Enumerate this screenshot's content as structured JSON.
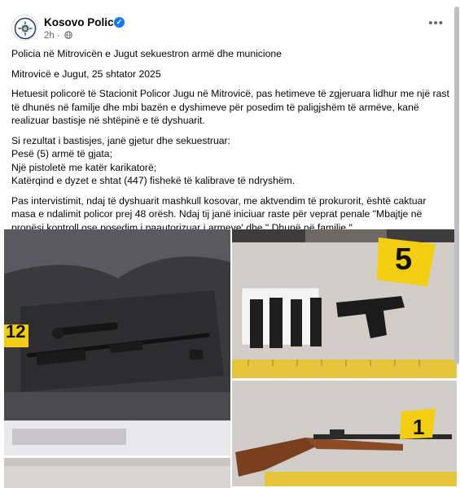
{
  "post": {
    "page_name": "Kosovo Police",
    "time": "2h",
    "more_label": "•••"
  },
  "body": {
    "headline": "Policia në Mitrovicën e Jugut sekuestron armë dhe municione",
    "dateline": "Mitrovicë e Jugut, 25 shtator 2025",
    "para1": "Hetuesit policorë të Stacionit Policor  Jugu në  Mitrovicë, pas hetimeve të zgjeruara lidhur me një rast të dhunës në familje dhe mbi bazën e dyshimeve për posedim të paligjshëm të armëve, kanë realizuar bastisje në shtëpinë e të dyshuarit.",
    "para2_intro": "Si rezultat i bastisjes, janë gjetur dhe sekuestruar:",
    "seized": [
      "Pesë (5) armë  të  gjata;",
      "Një pistoletë me katër karikatorë;",
      "Katërqind e dyzet e shtat (447) fishekë të kalibrave të ndryshëm."
    ],
    "para3": "Pas intervistimit, ndaj të dyshuarit mashkull kosovar, me aktvendim të prokurorit, është caktuar masa e ndalimit policor prej 48 orësh. Ndaj tij janë iniciuar raste për  veprat penale \"Mbajtje në pronësi kontroll ose posedim i paautorizuar i armeve' dhe \" Dhunë në familje \"."
  },
  "photos": {
    "evidence_marker_1": "12",
    "evidence_marker_2": "5",
    "evidence_marker_3": "1"
  },
  "colors": {
    "verified_blue": "#1877f2",
    "meta_gray": "#65676b",
    "marker_yellow": "#f3cd12"
  }
}
